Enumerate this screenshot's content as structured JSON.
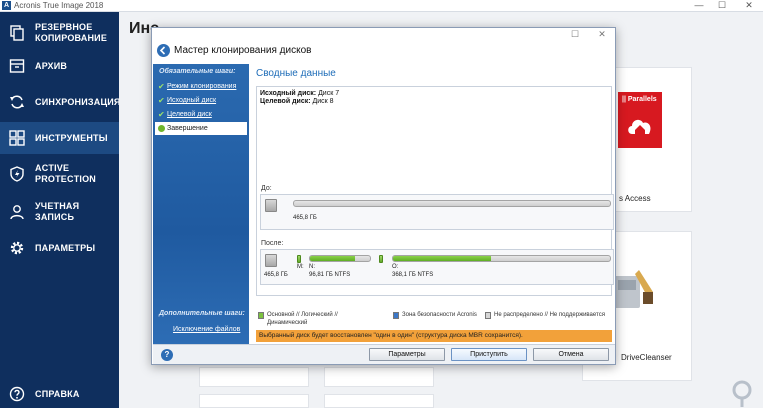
{
  "app": {
    "title": "Acronis True Image 2018",
    "logo_letter": "A",
    "min_glyph": "—",
    "max_glyph": "☐",
    "close_glyph": "✕"
  },
  "sidebar": {
    "items": [
      {
        "label": "РЕЗЕРВНОЕ КОПИРОВАНИЕ",
        "line1": "РЕЗЕРВНОЕ",
        "line2": "КОПИРОВАНИЕ",
        "icon": "copy-icon"
      },
      {
        "label": "АРХИВ",
        "icon": "archive-icon"
      },
      {
        "label": "СИНХРОНИЗАЦИЯ",
        "icon": "sync-icon"
      },
      {
        "label": "ИНСТРУМЕНТЫ",
        "icon": "tools-grid-icon",
        "active": true
      },
      {
        "label": "ACTIVE PROTECTION",
        "line1": "ACTIVE",
        "line2": "PROTECTION",
        "icon": "shield-icon"
      },
      {
        "label": "УЧЕТНАЯ ЗАПИСЬ",
        "icon": "user-icon"
      },
      {
        "label": "ПАРАМЕТРЫ",
        "icon": "gear-icon"
      },
      {
        "label": "СПРАВКА",
        "icon": "help-icon"
      }
    ]
  },
  "main": {
    "heading": "Инс",
    "tiles": {
      "parallels_brand": "|| Parallels",
      "parallels_access_label": "s Access",
      "drivecleanser_label": "DriveCleanser"
    }
  },
  "dialog": {
    "title": "Мастер клонирования дисков",
    "mandatory_steps_heading": "Обязательные шаги:",
    "steps": [
      {
        "label": "Режим клонирования",
        "done": true
      },
      {
        "label": "Исходный диск",
        "done": true
      },
      {
        "label": "Целевой диск",
        "done": true
      },
      {
        "label": "Завершение",
        "current": true
      }
    ],
    "extra_steps_heading": "Дополнительные шаги:",
    "extra_link": "Исключение файлов",
    "summary_title": "Сводные данные",
    "source_label": "Исходный диск:",
    "source_value": "Диск 7",
    "target_label": "Целевой диск:",
    "target_value": "Диск 8",
    "before_label": "До:",
    "after_label": "После:",
    "before_disk_size": "465,8 ГБ",
    "before_partition_size": "465,8 ГБ",
    "after_disk_size": "465,8 ГБ",
    "after_partitions": [
      {
        "letter": "M:",
        "name": "",
        "size": "",
        "fs": "",
        "fill": 0
      },
      {
        "letter": "",
        "name": "N:",
        "size": "96,81 ГБ  NTFS",
        "fs": "NTFS",
        "fill": 0.75
      },
      {
        "letter": "",
        "name": "O:",
        "size": "368,1 ГБ  NTFS",
        "fs": "NTFS",
        "fill": 0.45
      }
    ],
    "legend": [
      {
        "text": "Основной // Логический // Динамический",
        "color": "#7cc23f"
      },
      {
        "text": "Зона безопасности Acronis",
        "color": "#3c78c8"
      },
      {
        "text": "Не распределено // Не поддерживается",
        "color": "#d6d6d6"
      }
    ],
    "notice": "Выбранный диск будет восстановлен \"один в один\" (структура диска MBR сохранится).",
    "help_glyph": "?",
    "buttons": {
      "params": "Параметры",
      "proceed": "Приступить",
      "cancel": "Отмена"
    }
  }
}
